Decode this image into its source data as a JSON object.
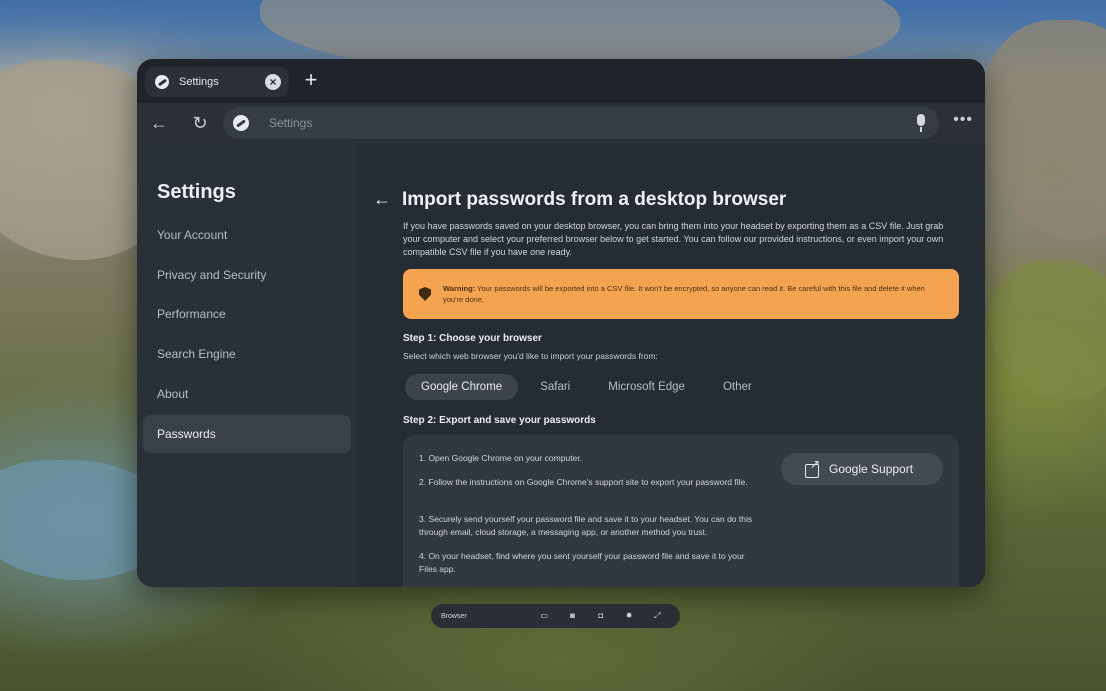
{
  "tab": {
    "title": "Settings",
    "close_glyph": "×",
    "new_tab_glyph": "+"
  },
  "toolbar": {
    "back_glyph": "←",
    "reload_glyph": "↻",
    "address_placeholder": "Settings",
    "more_glyph": "•••"
  },
  "sidebar": {
    "title": "Settings",
    "items": [
      {
        "label": "Your Account"
      },
      {
        "label": "Privacy and Security"
      },
      {
        "label": "Performance"
      },
      {
        "label": "Search Engine"
      },
      {
        "label": "About"
      },
      {
        "label": "Passwords",
        "active": true
      }
    ]
  },
  "main": {
    "back_glyph": "←",
    "title": "Import passwords from a desktop browser",
    "intro": "If you have passwords saved on your desktop browser, you can bring them into your headset by exporting them as a CSV file. Just grab your computer and select your preferred browser below to get started. You can follow our provided instructions, or even import your own compatible CSV file if you have one ready.",
    "warning": {
      "label": "Warning:",
      "text": "Your passwords will be exported into a CSV file. It won't be encrypted, so anyone can read it. Be careful with this file and delete it when you're done."
    },
    "step1": {
      "title": "Step 1: Choose your browser",
      "subtitle": "Select which web browser you'd like to import your passwords from:",
      "options": [
        {
          "label": "Google Chrome",
          "selected": true
        },
        {
          "label": "Safari"
        },
        {
          "label": "Microsoft Edge"
        },
        {
          "label": "Other"
        }
      ]
    },
    "step2": {
      "title": "Step 2: Export and save your passwords",
      "instructions": [
        "1. Open Google Chrome on your computer.",
        "2. Follow the instructions on Google Chrome's support site to export your password file.",
        "3. Securely send yourself your password file and save it to your headset. You can do this through email, cloud storage, a messaging app, or another method you trust.",
        "4. On your headset, find where you sent yourself your password file and save it to your Files app."
      ],
      "support_button": "Google Support"
    }
  },
  "taskbar": {
    "label": "Browser",
    "icons": [
      "monitor-icon",
      "headset-icon",
      "gamepad-icon",
      "brightness-icon",
      "expand-icon"
    ]
  },
  "colors": {
    "window_bg": "#262c34",
    "sidebar_bg": "#2a3038",
    "warning_bg": "#f4a451",
    "accent_text": "#eceef1"
  }
}
